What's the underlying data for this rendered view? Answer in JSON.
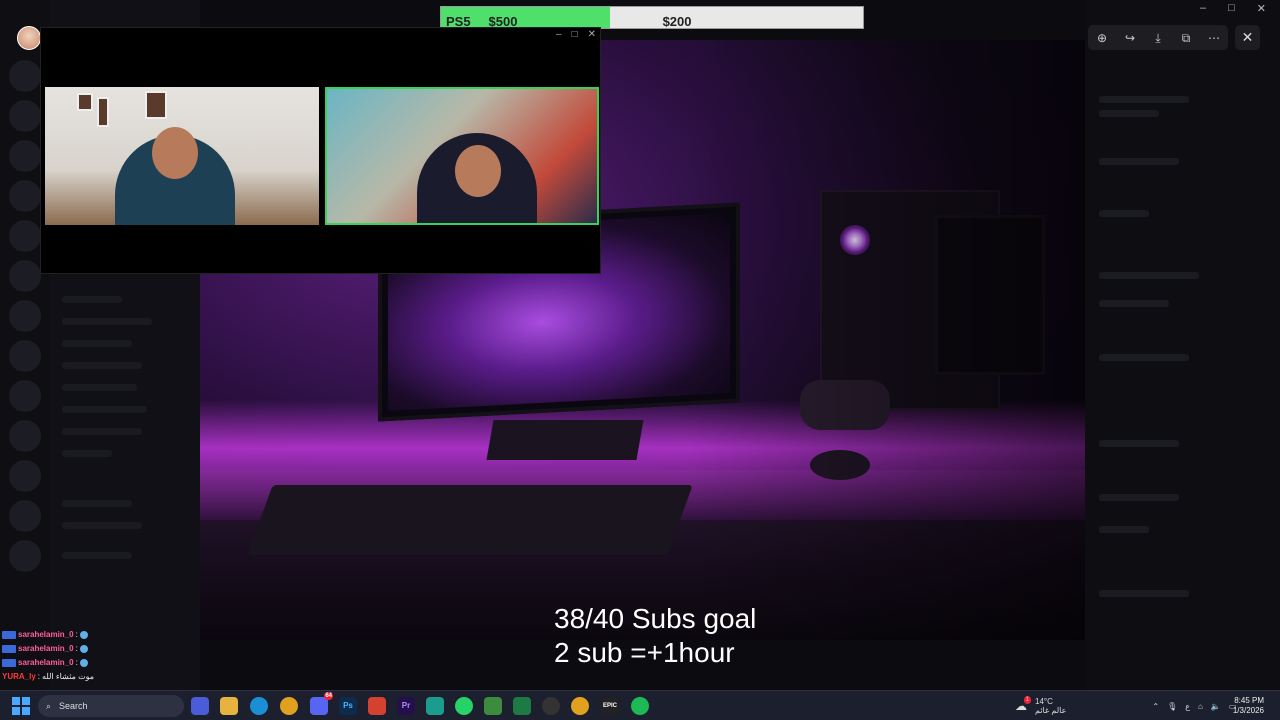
{
  "donation_goal": {
    "item": "PS5",
    "current": "$200",
    "target": "$500",
    "progress_fraction": 0.4,
    "fill_color": "#4ee06a"
  },
  "stream_overlay": {
    "subs_goal_line1": "38/40 Subs goal",
    "subs_goal_line2": "2 sub =+1hour"
  },
  "call_window": {
    "controls": [
      "–",
      "□",
      "✕"
    ],
    "active_speaker_border_color": "#3ad15a"
  },
  "viewer_toolbar": {
    "icons": [
      "zoom-in-icon",
      "share-icon",
      "download-icon",
      "open-external-icon",
      "more-icon"
    ],
    "glyphs": [
      "⊕",
      "↪",
      "⤓",
      "⧉",
      "⋯"
    ],
    "close_glyph": "✕"
  },
  "window_caption": [
    "–",
    "□",
    "✕"
  ],
  "chat": [
    {
      "name": "sarahelamin_0",
      "sep": ":"
    },
    {
      "name": "sarahelamin_0",
      "sep": ":"
    },
    {
      "name": "sarahelamin_0",
      "sep": ":"
    },
    {
      "name": "YURA_ly",
      "message": "موت مثشاء الله"
    }
  ],
  "taskbar": {
    "search_placeholder": "Search",
    "apps": [
      "file-explorer",
      "edge",
      "chrome",
      "discord",
      "photoshop",
      "brave",
      "premiere",
      "app",
      "whatsapp",
      "minecraft",
      "excel",
      "obs",
      "chrome-2",
      "epic-games",
      "spotify"
    ],
    "app_labels": [
      "",
      "",
      "",
      "",
      "Ps",
      "",
      "Pr",
      "",
      "",
      "",
      "",
      "",
      "",
      "EPIC",
      ""
    ],
    "discord_badge": "64",
    "weather_temp": "14°C",
    "weather_desc": "عالم غائم",
    "weather_badge": "1",
    "lang_indicator": "ع",
    "time": "8:45 PM",
    "date": "1/3/2026"
  }
}
